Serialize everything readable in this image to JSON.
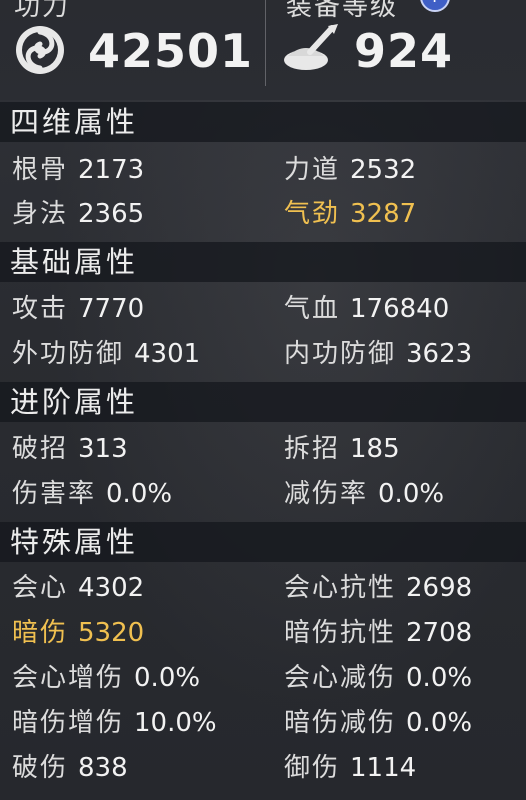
{
  "header": {
    "left_label": "功力",
    "right_label": "装备等级",
    "help_glyph": "?",
    "power_value": "42501",
    "gear_value": "924",
    "left_icon": "swirl-emblem-icon",
    "right_icon": "ingot-brush-icon"
  },
  "accent_color": "#f0c050",
  "sections": {
    "four_dim": {
      "title": "四维属性",
      "items": [
        {
          "label": "根骨",
          "value": "2173"
        },
        {
          "label": "力道",
          "value": "2532"
        },
        {
          "label": "身法",
          "value": "2365"
        },
        {
          "label": "气劲",
          "value": "3287",
          "highlight": true
        }
      ]
    },
    "basic": {
      "title": "基础属性",
      "items": [
        {
          "label": "攻击",
          "value": "7770"
        },
        {
          "label": "气血",
          "value": "176840"
        },
        {
          "label": "外功防御",
          "value": "4301"
        },
        {
          "label": "内功防御",
          "value": "3623"
        }
      ]
    },
    "advanced": {
      "title": "进阶属性",
      "items": [
        {
          "label": "破招",
          "value": "313"
        },
        {
          "label": "拆招",
          "value": "185"
        },
        {
          "label": "伤害率",
          "value": "0.0%"
        },
        {
          "label": "减伤率",
          "value": "0.0%"
        }
      ]
    },
    "special": {
      "title": "特殊属性",
      "items": [
        {
          "label": "会心",
          "value": "4302"
        },
        {
          "label": "会心抗性",
          "value": "2698"
        },
        {
          "label": "暗伤",
          "value": "5320",
          "highlight": true
        },
        {
          "label": "暗伤抗性",
          "value": "2708"
        },
        {
          "label": "会心增伤",
          "value": "0.0%"
        },
        {
          "label": "会心减伤",
          "value": "0.0%"
        },
        {
          "label": "暗伤增伤",
          "value": "10.0%"
        },
        {
          "label": "暗伤减伤",
          "value": "0.0%"
        },
        {
          "label": "破伤",
          "value": "838"
        },
        {
          "label": "御伤",
          "value": "1114"
        }
      ]
    }
  }
}
